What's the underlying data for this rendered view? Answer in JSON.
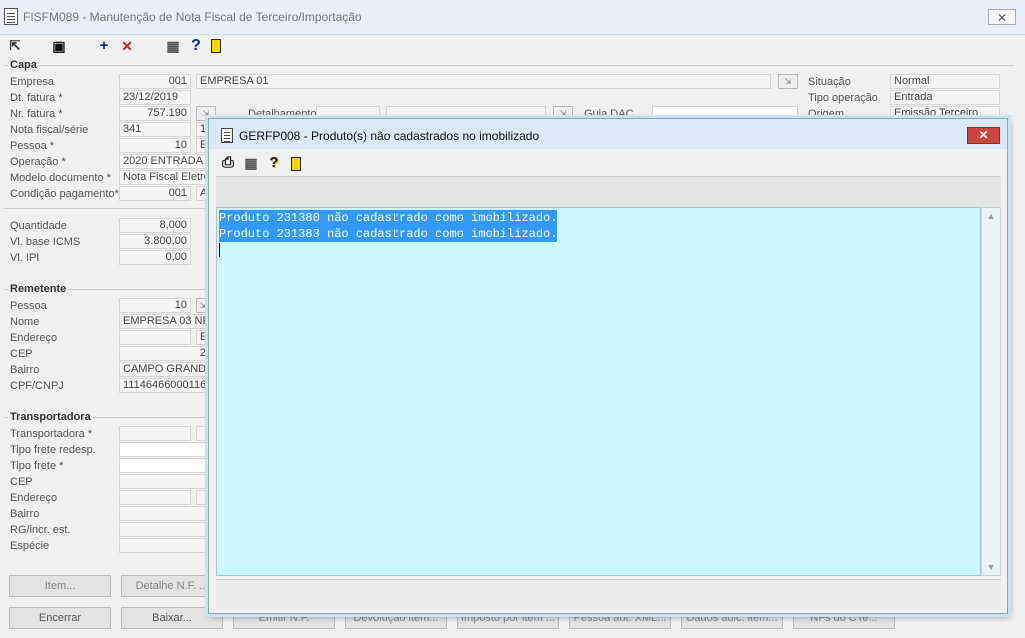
{
  "main": {
    "title": "FISFM089 - Manutenção de Nota Fiscal de Terceiro/Importação",
    "close_label": "⨯",
    "toolbar": {
      "open_glyph": "⇱",
      "save_glyph": "▣",
      "add_glyph": "+",
      "delete_glyph": "✕",
      "calendar_glyph": "▦",
      "help_glyph": "?",
      "exit_glyph": "▯"
    }
  },
  "capa": {
    "title": "Capa",
    "empresa": {
      "label": "Empresa",
      "code": "001",
      "name": "EMPRESA 01"
    },
    "dt_fatura": {
      "label": "Dt. fatura *",
      "value": "23/12/2019"
    },
    "nr_fatura": {
      "label": "Nr. fatura *",
      "value": "757.190"
    },
    "nota_fiscal": {
      "label": "Nota fiscal/série",
      "value": "341",
      "serie": "10"
    },
    "pessoa": {
      "label": "Pessoa *",
      "value": "10",
      "name": "EM"
    },
    "operacao": {
      "label": "Operação *",
      "value": "2020 ENTRADA N"
    },
    "modelo_documento": {
      "label": "Modelo documento *",
      "value": "Nota Fiscal Eletrô"
    },
    "condicao_pagamento": {
      "label": "Condição pagamento*",
      "value": "001",
      "extra": "A"
    },
    "detalhamento": {
      "label": "Detalhamento"
    },
    "guia_dac": {
      "label": "Guia DAC"
    },
    "situacao": {
      "label": "Situação",
      "value": "Normal"
    },
    "tipo_operacao": {
      "label": "Tipo operação",
      "value": "Entrada"
    },
    "origem": {
      "label": "Origem",
      "value": "Emissão Terceiro"
    }
  },
  "totais": {
    "quantidade": {
      "label": "Quantidade",
      "value": "8,000"
    },
    "vl_base_icms": {
      "label": "Vl. base ICMS",
      "value": "3.800,00"
    },
    "vl_ipi": {
      "label": "Vl. IPI",
      "value": "0,00"
    }
  },
  "remetente": {
    "title": "Remetente",
    "pessoa": {
      "label": "Pessoa",
      "value": "10"
    },
    "nome": {
      "label": "Nome",
      "value": "EMPRESA 03 NFC"
    },
    "endereco": {
      "label": "Endereço",
      "value": "ES"
    },
    "cep": {
      "label": "CEP",
      "value": "2"
    },
    "bairro": {
      "label": "Bairro",
      "value": "CAMPO GRANDE"
    },
    "cpf_cnpj": {
      "label": "CPF/CNPJ",
      "value": "11146466000116"
    }
  },
  "transportadora": {
    "title": "Transportadora",
    "transportadora": {
      "label": "Transportadora *"
    },
    "tipo_frete_redesp": {
      "label": "Tipo frete redesp."
    },
    "tipo_frete": {
      "label": "Tipo frete *"
    },
    "cep": {
      "label": "CEP"
    },
    "endereco": {
      "label": "Endereço"
    },
    "bairro": {
      "label": "Bairro"
    },
    "rg_incr": {
      "label": "RG/incr. est."
    },
    "especie": {
      "label": "Espécie"
    }
  },
  "buttons": {
    "item": "Item...",
    "detalhe_nf": "Detalhe N.F. ...",
    "encerrar": "Encerrar",
    "baixar": "Baixar...",
    "emitir_nf": "Emitir N.F.",
    "devolucao_item": "Devolução item...",
    "imposto_por_item": "Imposto por item ...",
    "pessoa_aut_xml": "Pessoa aut. XML...",
    "dados_adic_item": "Dados adic. item...",
    "nfs_do_cte": "NFs do CTe..."
  },
  "dialog": {
    "title": "GERFP008 - Produto(s) não cadastrados no imobilizado",
    "close_label": "✕",
    "toolbar": {
      "print_glyph": "⎙",
      "calendar_glyph": "▦",
      "help_glyph": "?",
      "exit_glyph": "▯"
    },
    "messages": [
      "Produto 231380 não cadastrado como imobilizado.",
      "Produto 231383 não cadastrado como imobilizado."
    ]
  }
}
